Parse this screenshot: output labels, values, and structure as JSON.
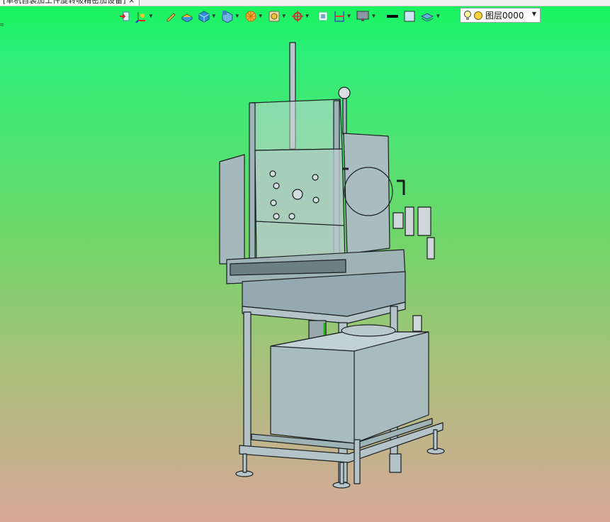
{
  "document_tab": {
    "title": "[单机自装加工件旋转吸精密加设备] ×"
  },
  "side_mark": "≈",
  "toolbar": {
    "buttons": [
      {
        "icon": "import-icon",
        "dropdown": false
      },
      {
        "icon": "axis-icon",
        "dropdown": true
      },
      {
        "icon": "pencil-icon",
        "dropdown": false
      },
      {
        "icon": "box-stack-icon",
        "dropdown": false
      },
      {
        "icon": "cube-icon",
        "dropdown": true
      },
      {
        "icon": "cube-view-icon",
        "dropdown": true
      },
      {
        "icon": "render-icon",
        "dropdown": true
      },
      {
        "icon": "display-icon",
        "dropdown": true
      },
      {
        "icon": "rotate-icon",
        "dropdown": true
      },
      {
        "icon": "frame-icon",
        "dropdown": false
      },
      {
        "icon": "section-icon",
        "dropdown": true
      },
      {
        "icon": "monitor-icon",
        "dropdown": true
      },
      {
        "icon": "line-color-icon",
        "dropdown": false
      },
      {
        "icon": "fill-color-icon",
        "dropdown": false
      },
      {
        "icon": "layers-icon",
        "dropdown": true
      }
    ]
  },
  "layer_selector": {
    "value": "图层0000"
  },
  "colors": {
    "bg_top": "#15f45a",
    "bg_bottom": "#d7a89a",
    "model_fill": "#9fb4b8",
    "model_edge": "#1a1f22"
  }
}
